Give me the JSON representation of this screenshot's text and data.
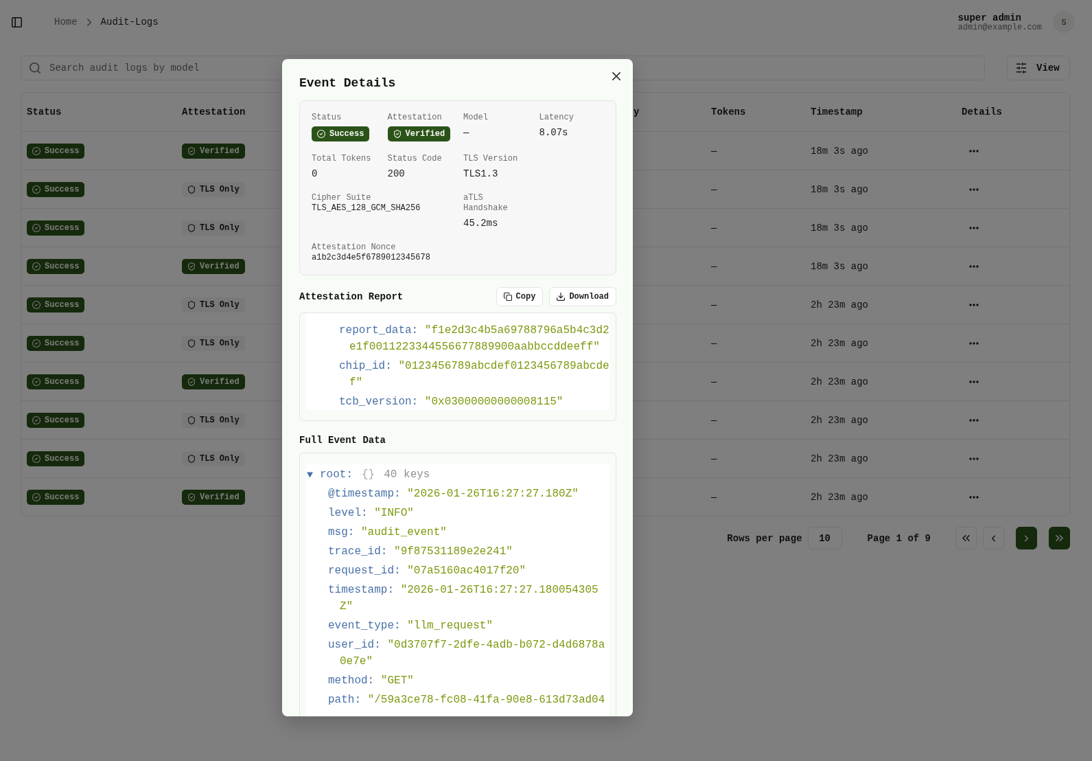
{
  "header": {
    "breadcrumbs": [
      {
        "label": "Home",
        "current": false
      },
      {
        "label": "Audit-Logs",
        "current": true
      }
    ],
    "user": {
      "name": "super admin",
      "email": "admin@example.com",
      "initial": "s"
    }
  },
  "toolbar": {
    "search": {
      "placeholder": "Search audit logs by model"
    },
    "view_button": "View"
  },
  "table": {
    "columns": [
      "Status",
      "Attestation",
      "y",
      "Tokens",
      "Timestamp",
      "Details"
    ],
    "rows": [
      {
        "status": {
          "kind": "success",
          "label": "Success"
        },
        "attestation": {
          "kind": "verified",
          "label": "Verified"
        },
        "tokens": "—",
        "timestamp": "18m 3s ago"
      },
      {
        "status": {
          "kind": "success",
          "label": "Success"
        },
        "attestation": {
          "kind": "tls_only",
          "label": "TLS Only"
        },
        "tokens": "—",
        "timestamp": "18m 3s ago"
      },
      {
        "status": {
          "kind": "success",
          "label": "Success"
        },
        "attestation": {
          "kind": "tls_only",
          "label": "TLS Only"
        },
        "tokens": "—",
        "timestamp": "18m 3s ago"
      },
      {
        "status": {
          "kind": "success",
          "label": "Success"
        },
        "attestation": {
          "kind": "verified",
          "label": "Verified"
        },
        "tokens": "—",
        "timestamp": "18m 3s ago"
      },
      {
        "status": {
          "kind": "success",
          "label": "Success"
        },
        "attestation": {
          "kind": "tls_only",
          "label": "TLS Only"
        },
        "tokens": "—",
        "timestamp": "2h 23m ago"
      },
      {
        "status": {
          "kind": "success",
          "label": "Success"
        },
        "attestation": {
          "kind": "tls_only",
          "label": "TLS Only"
        },
        "tokens": "—",
        "timestamp": "2h 23m ago"
      },
      {
        "status": {
          "kind": "success",
          "label": "Success"
        },
        "attestation": {
          "kind": "verified",
          "label": "Verified"
        },
        "tokens": "—",
        "timestamp": "2h 23m ago"
      },
      {
        "status": {
          "kind": "success",
          "label": "Success"
        },
        "attestation": {
          "kind": "tls_only",
          "label": "TLS Only"
        },
        "tokens": "—",
        "timestamp": "2h 23m ago"
      },
      {
        "status": {
          "kind": "success",
          "label": "Success"
        },
        "attestation": {
          "kind": "tls_only",
          "label": "TLS Only"
        },
        "tokens": "—",
        "timestamp": "2h 23m ago"
      },
      {
        "status": {
          "kind": "success",
          "label": "Success"
        },
        "attestation": {
          "kind": "verified",
          "label": "Verified"
        },
        "tokens": "—",
        "timestamp": "2h 23m ago"
      }
    ]
  },
  "pagination": {
    "rows_per_page_label": "Rows per page",
    "rows_per_page": "10",
    "page_label": "Page 1 of 9",
    "buttons": [
      {
        "kind": "first",
        "disabled": true
      },
      {
        "kind": "prev",
        "disabled": true
      },
      {
        "kind": "next",
        "disabled": false
      },
      {
        "kind": "last",
        "disabled": false
      }
    ]
  },
  "dialog": {
    "title": "Event Details",
    "summary": [
      {
        "label": "Status",
        "kind": "badge",
        "badge": {
          "kind": "success",
          "label": "Success"
        }
      },
      {
        "label": "Attestation",
        "kind": "badge",
        "badge": {
          "kind": "verified",
          "label": "Verified"
        }
      },
      {
        "label": "Model",
        "kind": "text",
        "value": "—"
      },
      {
        "label": "Latency",
        "kind": "text",
        "value": "8.07s"
      },
      {
        "label": "Total Tokens",
        "kind": "text",
        "value": "0"
      },
      {
        "label": "Status Code",
        "kind": "text",
        "value": "200"
      },
      {
        "label": "TLS Version",
        "kind": "text",
        "value": "TLS1.3"
      },
      {
        "label": "Cipher Suite",
        "kind": "code",
        "value": "TLS_AES_128_GCM_SHA256"
      },
      {
        "label": "aTLS Handshake",
        "kind": "text",
        "value": "45.2ms"
      },
      {
        "label": "Attestation Nonce",
        "kind": "code",
        "value": "a1b2c3d4e5f6789012345678"
      }
    ],
    "report": {
      "title": "Attestation Report",
      "actions": [
        {
          "kind": "copy",
          "label": "Copy"
        },
        {
          "kind": "download",
          "label": "Download"
        }
      ],
      "entries": [
        {
          "key": "report_data:",
          "value": "\"f1e2d3c4b5a69788796a5b4c3d2e1f0011223344556677889900aabbccddeeff\""
        },
        {
          "key": "chip_id:",
          "value": "\"0123456789abcdef0123456789abcdef\""
        },
        {
          "key": "tcb_version:",
          "value": "\"0x03000000000008115\""
        }
      ]
    },
    "event_data": {
      "title": "Full Event Data",
      "root": {
        "key": "root:",
        "expanded": true,
        "brackets": "{}",
        "count": "40 keys",
        "children": [
          {
            "key": "@timestamp:",
            "value": "\"2026-01-26T16:27:27.180Z\""
          },
          {
            "key": "level:",
            "value": "\"INFO\""
          },
          {
            "key": "msg:",
            "value": "\"audit_event\""
          },
          {
            "key": "trace_id:",
            "value": "\"9f87531189e2e241\""
          },
          {
            "key": "request_id:",
            "value": "\"07a5160ac4017f20\""
          },
          {
            "key": "timestamp:",
            "value": "\"2026-01-26T16:27:27.180054305Z\""
          },
          {
            "key": "event_type:",
            "value": "\"llm_request\""
          },
          {
            "key": "user_id:",
            "value": "\"0d3707f7-2dfe-4adb-b072-d4d6878a0e7e\""
          },
          {
            "key": "method:",
            "value": "\"GET\""
          },
          {
            "key": "path:",
            "value": "\"/59a3ce78-fc08-41fa-90e8-613d73ad04"
          }
        ]
      }
    }
  }
}
